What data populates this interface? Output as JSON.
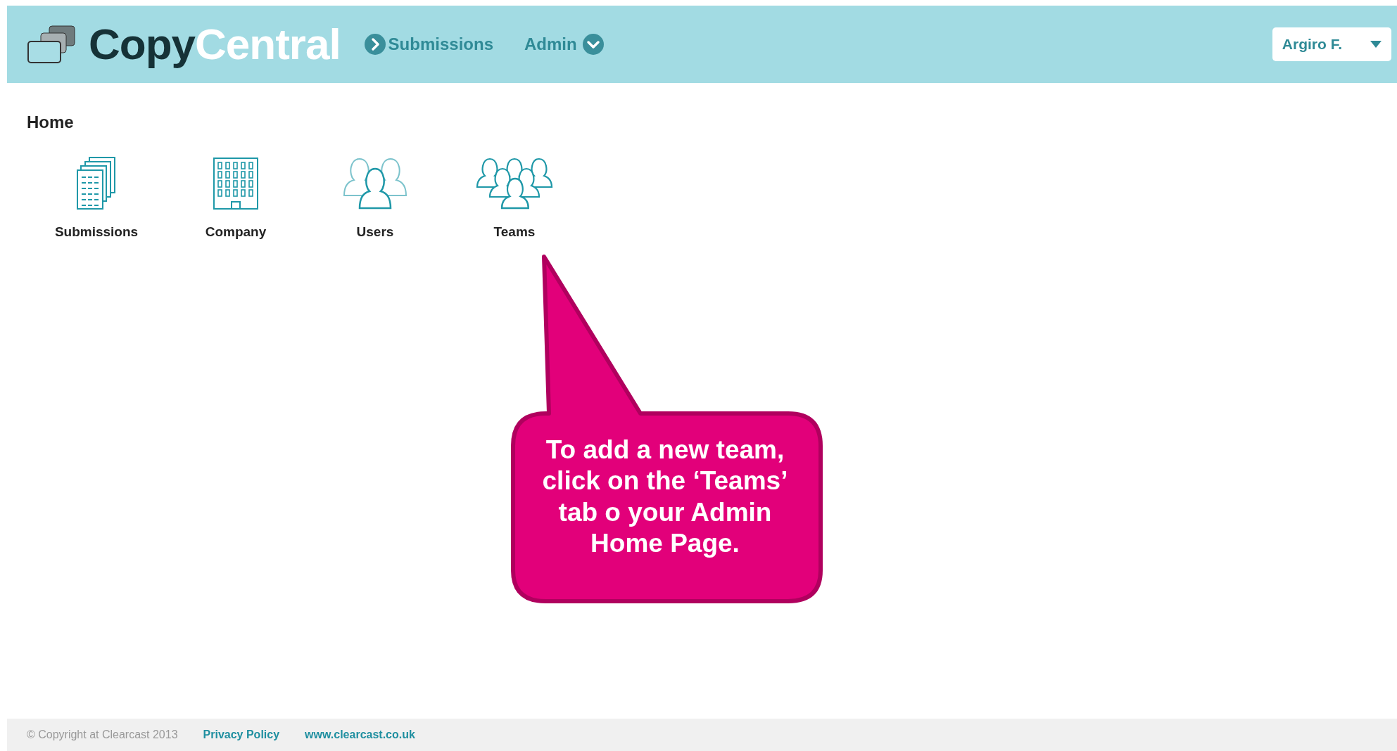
{
  "header": {
    "logo": {
      "dark": "Copy",
      "light": "Central"
    },
    "nav": [
      {
        "label": "Submissions",
        "kind": "go"
      },
      {
        "label": "Admin",
        "kind": "dropdown"
      }
    ],
    "user_menu": {
      "label": "Argiro F."
    }
  },
  "page_title": "Home",
  "tiles": [
    {
      "label": "Submissions",
      "kind": "documents"
    },
    {
      "label": "Company",
      "kind": "building"
    },
    {
      "label": "Users",
      "kind": "users"
    },
    {
      "label": "Teams",
      "kind": "teams"
    }
  ],
  "callout": {
    "text": "To add a new team, click on the ‘Teams’ tab o your  Admin Home Page."
  },
  "footer": {
    "copyright": "© Copyright at Clearcast 2013",
    "links": [
      "Privacy Policy",
      "www.clearcast.co.uk"
    ]
  }
}
